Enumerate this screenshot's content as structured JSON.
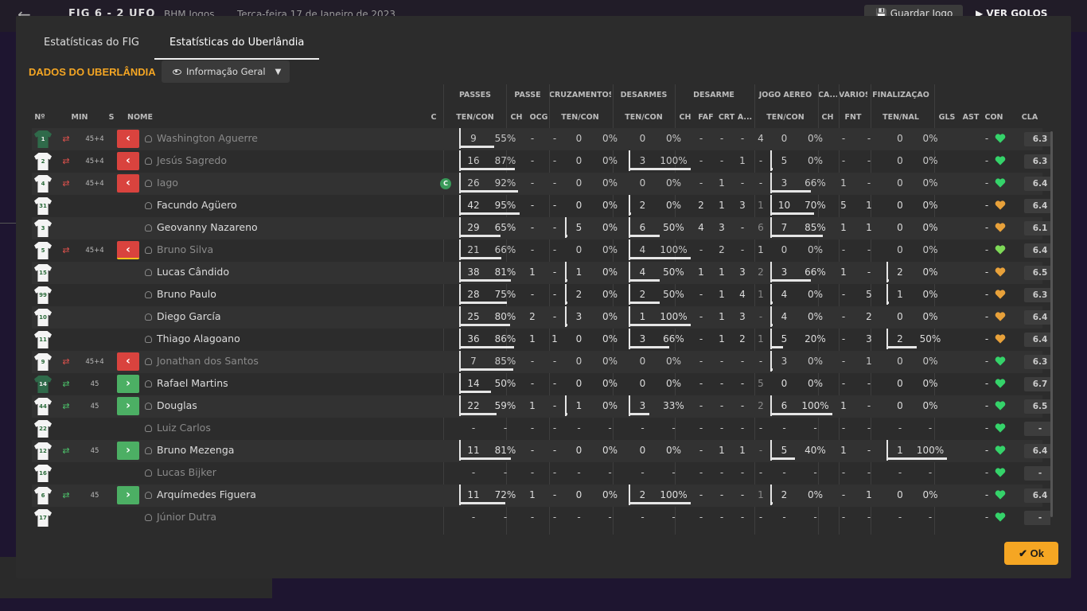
{
  "topbar": {
    "back_icon": "back-arrow-icon",
    "score": "FIG  6 - 2  UFO",
    "venue": "BHM Jogos",
    "date": "Terça-feira 17 de Janeiro de 2023",
    "save_label": "Guardar Jogo",
    "goals_label": "VER GOLOS"
  },
  "tabs": [
    {
      "label": "Estatísticas do FIG",
      "active": false
    },
    {
      "label": "Estatísticas do Uberlândia",
      "active": true
    }
  ],
  "section_title": "DADOS DO UBERLÂNDIA",
  "view_select": {
    "value": "Informação Geral"
  },
  "group_headers": [
    "PASSES",
    "PASSE",
    "CRUZAMENTOS",
    "DESARMES",
    "DESARME",
    "JOGO AÉREO",
    "CA...",
    "VÁRIOS",
    "FINALIZAÇÃO"
  ],
  "columns": [
    "Nº",
    "MIN",
    "S",
    "NOME",
    "C",
    "TEN/CON",
    "CH",
    "OCG",
    "TEN/CON",
    "TEN/CON",
    "CH",
    "FAF",
    "CRT",
    "A...",
    "TEN/CON",
    "CH",
    "FNT",
    "TEN/NAL",
    "GLS",
    "AST",
    "CON",
    "CLA"
  ],
  "colors": {
    "accent": "#f5a623",
    "sub_out": "#d9433e",
    "sub_in": "#4caf64",
    "yellow_card": "#f2c21b",
    "heart_green": "#35d36a",
    "heart_lime": "#7ed957",
    "heart_orange": "#e8a13a"
  },
  "players": [
    {
      "no": "1",
      "gk": true,
      "sub": "out",
      "min": "45+4",
      "name": "Washington Aguerre",
      "dim": true,
      "cap": "",
      "pass": [
        "9",
        "55%"
      ],
      "pch": "-",
      "ocg": "-",
      "cross": [
        "0",
        "0%"
      ],
      "tack": [
        "0",
        "0%"
      ],
      "ch": "-",
      "faf": "-",
      "crt": "-",
      "a": "4",
      "air": [
        "0",
        "0%"
      ],
      "ca": "-",
      "fnt": "-",
      "fin": [
        "0",
        "0%"
      ],
      "gls": "",
      "ast": "-",
      "con": "green",
      "cla": "6.3"
    },
    {
      "no": "2",
      "gk": false,
      "sub": "out",
      "min": "45+4",
      "name": "Jesús Sagredo",
      "dim": true,
      "cap": "",
      "pass": [
        "16",
        "87%"
      ],
      "pch": "-",
      "ocg": "-",
      "cross": [
        "0",
        "0%"
      ],
      "tack": [
        "3",
        "100%"
      ],
      "ch": "-",
      "faf": "-",
      "crt": "1",
      "a": "-",
      "air": [
        "5",
        "0%"
      ],
      "ca": "-",
      "fnt": "-",
      "fin": [
        "0",
        "0%"
      ],
      "gls": "",
      "ast": "-",
      "con": "green",
      "cla": "6.3"
    },
    {
      "no": "4",
      "gk": false,
      "sub": "out",
      "min": "45+4",
      "name": "Iago",
      "dim": true,
      "cap": "C",
      "pass": [
        "26",
        "92%"
      ],
      "pch": "-",
      "ocg": "-",
      "cross": [
        "0",
        "0%"
      ],
      "tack": [
        "0",
        "0%"
      ],
      "ch": "-",
      "faf": "1",
      "crt": "-",
      "a": "-",
      "air": [
        "3",
        "66%"
      ],
      "ca": "1",
      "fnt": "-",
      "fin": [
        "0",
        "0%"
      ],
      "gls": "",
      "ast": "-",
      "con": "green",
      "cla": "6.4"
    },
    {
      "no": "31",
      "gk": false,
      "sub": "",
      "min": "",
      "name": "Facundo Agüero",
      "dim": false,
      "cap": "",
      "pass": [
        "42",
        "95%"
      ],
      "pch": "-",
      "ocg": "-",
      "cross": [
        "0",
        "0%"
      ],
      "tack": [
        "2",
        "0%"
      ],
      "ch": "2",
      "faf": "1",
      "crt": "3",
      "a": "1",
      "air": [
        "10",
        "70%"
      ],
      "ca": "5",
      "fnt": "1",
      "fin": [
        "0",
        "0%"
      ],
      "gls": "",
      "ast": "-",
      "con": "orange",
      "cla": "6.4"
    },
    {
      "no": "3",
      "gk": false,
      "sub": "",
      "min": "",
      "name": "Geovanny Nazareno",
      "dim": false,
      "cap": "",
      "pass": [
        "29",
        "65%"
      ],
      "pch": "-",
      "ocg": "-",
      "cross": [
        "5",
        "0%"
      ],
      "tack": [
        "6",
        "50%"
      ],
      "ch": "4",
      "faf": "3",
      "crt": "-",
      "a": "6",
      "air": [
        "7",
        "85%"
      ],
      "ca": "1",
      "fnt": "1",
      "fin": [
        "0",
        "0%"
      ],
      "gls": "",
      "ast": "-",
      "con": "orange",
      "cla": "6.1"
    },
    {
      "no": "5",
      "gk": false,
      "sub": "out",
      "yellow": true,
      "min": "45+4",
      "name": "Bruno Silva",
      "dim": true,
      "cap": "",
      "pass": [
        "21",
        "66%"
      ],
      "pch": "-",
      "ocg": "-",
      "cross": [
        "0",
        "0%"
      ],
      "tack": [
        "4",
        "100%"
      ],
      "ch": "-",
      "faf": "2",
      "crt": "-",
      "a": "1",
      "air": [
        "0",
        "0%"
      ],
      "ca": "-",
      "fnt": "-",
      "fin": [
        "0",
        "0%"
      ],
      "gls": "",
      "ast": "-",
      "con": "lime",
      "cla": "6.4"
    },
    {
      "no": "15",
      "gk": false,
      "sub": "",
      "min": "",
      "name": "Lucas Cândido",
      "dim": false,
      "cap": "",
      "pass": [
        "38",
        "81%"
      ],
      "pch": "1",
      "ocg": "-",
      "cross": [
        "1",
        "0%"
      ],
      "tack": [
        "4",
        "50%"
      ],
      "ch": "1",
      "faf": "1",
      "crt": "3",
      "a": "2",
      "air": [
        "3",
        "66%"
      ],
      "ca": "1",
      "fnt": "-",
      "fin": [
        "2",
        "0%"
      ],
      "gls": "",
      "ast": "-",
      "con": "orange",
      "cla": "6.5"
    },
    {
      "no": "99",
      "gk": false,
      "sub": "",
      "min": "",
      "name": "Bruno Paulo",
      "dim": false,
      "cap": "",
      "pass": [
        "28",
        "75%"
      ],
      "pch": "-",
      "ocg": "-",
      "cross": [
        "2",
        "0%"
      ],
      "tack": [
        "2",
        "50%"
      ],
      "ch": "-",
      "faf": "1",
      "crt": "4",
      "a": "1",
      "air": [
        "4",
        "0%"
      ],
      "ca": "-",
      "fnt": "5",
      "fin": [
        "1",
        "0%"
      ],
      "gls": "",
      "ast": "-",
      "con": "orange",
      "cla": "6.3"
    },
    {
      "no": "10",
      "gk": false,
      "sub": "",
      "min": "",
      "name": "Diego García",
      "dim": false,
      "cap": "",
      "pass": [
        "25",
        "80%"
      ],
      "pch": "2",
      "ocg": "-",
      "cross": [
        "3",
        "0%"
      ],
      "tack": [
        "1",
        "100%"
      ],
      "ch": "-",
      "faf": "1",
      "crt": "3",
      "a": "-",
      "air": [
        "4",
        "0%"
      ],
      "ca": "-",
      "fnt": "2",
      "fin": [
        "0",
        "0%"
      ],
      "gls": "",
      "ast": "-",
      "con": "orange",
      "cla": "6.4"
    },
    {
      "no": "11",
      "gk": false,
      "sub": "",
      "min": "",
      "name": "Thiago Alagoano",
      "dim": false,
      "cap": "",
      "pass": [
        "36",
        "86%"
      ],
      "pch": "1",
      "ocg": "1",
      "cross": [
        "0",
        "0%"
      ],
      "tack": [
        "3",
        "66%"
      ],
      "ch": "-",
      "faf": "1",
      "crt": "2",
      "a": "1",
      "air": [
        "5",
        "20%"
      ],
      "ca": "-",
      "fnt": "3",
      "fin": [
        "2",
        "50%"
      ],
      "gls": "",
      "ast": "-",
      "con": "orange",
      "cla": "6.4"
    },
    {
      "no": "9",
      "gk": false,
      "sub": "out",
      "min": "45+4",
      "name": "Jonathan dos Santos",
      "dim": true,
      "cap": "",
      "pass": [
        "7",
        "85%"
      ],
      "pch": "-",
      "ocg": "-",
      "cross": [
        "0",
        "0%"
      ],
      "tack": [
        "0",
        "0%"
      ],
      "ch": "-",
      "faf": "-",
      "crt": "-",
      "a": "-",
      "air": [
        "3",
        "0%"
      ],
      "ca": "-",
      "fnt": "1",
      "fin": [
        "0",
        "0%"
      ],
      "gls": "",
      "ast": "-",
      "con": "green",
      "cla": "6.3"
    },
    {
      "no": "14",
      "gk": true,
      "sub": "in",
      "min": "45",
      "name": "Rafael Martins",
      "dim": false,
      "cap": "",
      "pass": [
        "14",
        "50%"
      ],
      "pch": "-",
      "ocg": "-",
      "cross": [
        "0",
        "0%"
      ],
      "tack": [
        "0",
        "0%"
      ],
      "ch": "-",
      "faf": "-",
      "crt": "-",
      "a": "5",
      "air": [
        "0",
        "0%"
      ],
      "ca": "-",
      "fnt": "-",
      "fin": [
        "0",
        "0%"
      ],
      "gls": "",
      "ast": "-",
      "con": "green",
      "cla": "6.7"
    },
    {
      "no": "44",
      "gk": false,
      "sub": "in",
      "min": "45",
      "name": "Douglas",
      "dim": false,
      "cap": "",
      "pass": [
        "22",
        "59%"
      ],
      "pch": "1",
      "ocg": "-",
      "cross": [
        "1",
        "0%"
      ],
      "tack": [
        "3",
        "33%"
      ],
      "ch": "-",
      "faf": "-",
      "crt": "-",
      "a": "2",
      "air": [
        "6",
        "100%"
      ],
      "ca": "1",
      "fnt": "-",
      "fin": [
        "0",
        "0%"
      ],
      "gls": "",
      "ast": "-",
      "con": "green",
      "cla": "6.5"
    },
    {
      "no": "22",
      "gk": false,
      "sub": "",
      "min": "",
      "name": "Luiz Carlos",
      "dim": true,
      "cap": "",
      "pass": [
        "-",
        "-"
      ],
      "pch": "-",
      "ocg": "-",
      "cross": [
        "-",
        "-"
      ],
      "tack": [
        "-",
        "-"
      ],
      "ch": "-",
      "faf": "-",
      "crt": "-",
      "a": "-",
      "air": [
        "-",
        "-"
      ],
      "ca": "-",
      "fnt": "-",
      "fin": [
        "-",
        "-"
      ],
      "gls": "",
      "ast": "-",
      "con": "green",
      "cla": "-"
    },
    {
      "no": "12",
      "gk": false,
      "sub": "in",
      "min": "45",
      "name": "Bruno Mezenga",
      "dim": false,
      "cap": "",
      "pass": [
        "11",
        "81%"
      ],
      "pch": "-",
      "ocg": "-",
      "cross": [
        "0",
        "0%"
      ],
      "tack": [
        "0",
        "0%"
      ],
      "ch": "-",
      "faf": "1",
      "crt": "1",
      "a": "-",
      "air": [
        "5",
        "40%"
      ],
      "ca": "1",
      "fnt": "-",
      "fin": [
        "1",
        "100%"
      ],
      "gls": "",
      "ast": "-",
      "con": "green",
      "cla": "6.4"
    },
    {
      "no": "16",
      "gk": false,
      "sub": "",
      "min": "",
      "name": "Lucas Bijker",
      "dim": true,
      "cap": "",
      "pass": [
        "-",
        "-"
      ],
      "pch": "-",
      "ocg": "-",
      "cross": [
        "-",
        "-"
      ],
      "tack": [
        "-",
        "-"
      ],
      "ch": "-",
      "faf": "-",
      "crt": "-",
      "a": "-",
      "air": [
        "-",
        "-"
      ],
      "ca": "-",
      "fnt": "-",
      "fin": [
        "-",
        "-"
      ],
      "gls": "",
      "ast": "-",
      "con": "green",
      "cla": "-"
    },
    {
      "no": "6",
      "gk": false,
      "sub": "in",
      "min": "45",
      "name": "Arquímedes Figuera",
      "dim": false,
      "cap": "",
      "pass": [
        "11",
        "72%"
      ],
      "pch": "1",
      "ocg": "-",
      "cross": [
        "0",
        "0%"
      ],
      "tack": [
        "2",
        "100%"
      ],
      "ch": "-",
      "faf": "-",
      "crt": "-",
      "a": "1",
      "air": [
        "2",
        "0%"
      ],
      "ca": "-",
      "fnt": "1",
      "fin": [
        "0",
        "0%"
      ],
      "gls": "",
      "ast": "-",
      "con": "green",
      "cla": "6.4"
    },
    {
      "no": "17",
      "gk": false,
      "sub": "",
      "min": "",
      "name": "Júnior Dutra",
      "dim": true,
      "cap": "",
      "pass": [
        "-",
        "-"
      ],
      "pch": "-",
      "ocg": "-",
      "cross": [
        "-",
        "-"
      ],
      "tack": [
        "-",
        "-"
      ],
      "ch": "-",
      "faf": "-",
      "crt": "-",
      "a": "-",
      "air": [
        "-",
        "-"
      ],
      "ca": "-",
      "fnt": "-",
      "fin": [
        "-",
        "-"
      ],
      "gls": "",
      "ast": "-",
      "con": "green",
      "cla": "-"
    }
  ],
  "ok_label": "Ok"
}
